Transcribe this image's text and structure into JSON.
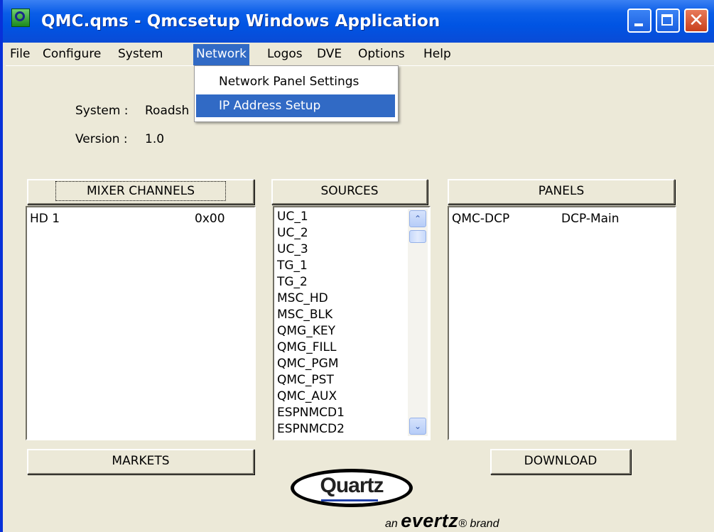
{
  "window": {
    "title": "QMC.qms - Qmcsetup Windows Application",
    "close_glyph": "✕"
  },
  "menu": [
    {
      "label": "File"
    },
    {
      "label": "Configure"
    },
    {
      "label": "System"
    },
    {
      "label": "Network"
    },
    {
      "label": "Logos"
    },
    {
      "label": "DVE"
    },
    {
      "label": "Options"
    },
    {
      "label": "Help"
    }
  ],
  "active_menu": "Network",
  "dropdown": {
    "items": [
      {
        "label": "Network Panel Settings"
      },
      {
        "label": "IP Address Setup"
      }
    ],
    "selected": "IP Address Setup"
  },
  "info": {
    "system_label": "System :",
    "system_value": "Roadsh",
    "version_label": "Version :",
    "version_value": "1.0"
  },
  "buttons": {
    "mixer_channels": "MIXER CHANNELS",
    "sources": "SOURCES",
    "panels": "PANELS",
    "markets": "MARKETS",
    "download": "DOWNLOAD"
  },
  "mixer_channels": [
    {
      "name": "HD 1",
      "value": "0x00"
    }
  ],
  "sources": [
    "UC_1",
    "UC_2",
    "UC_3",
    "TG_1",
    "TG_2",
    "MSC_HD",
    "MSC_BLK",
    "QMG_KEY",
    "QMG_FILL",
    "QMC_PGM",
    "QMC_PST",
    "QMC_AUX",
    "ESPNMCD1",
    "ESPNMCD2"
  ],
  "panels": [
    {
      "name": "QMC-DCP",
      "value": "DCP-Main"
    }
  ],
  "scroll_icons": {
    "up": "⌃",
    "down": "⌄"
  },
  "logo": {
    "name": "Quartz",
    "an": "an",
    "brand": "evertz",
    "reg": "®",
    "suffix": "brand"
  },
  "colors": {
    "titlebar": "#0054e3",
    "menu_highlight": "#316ac5",
    "face": "#ece9d8"
  }
}
